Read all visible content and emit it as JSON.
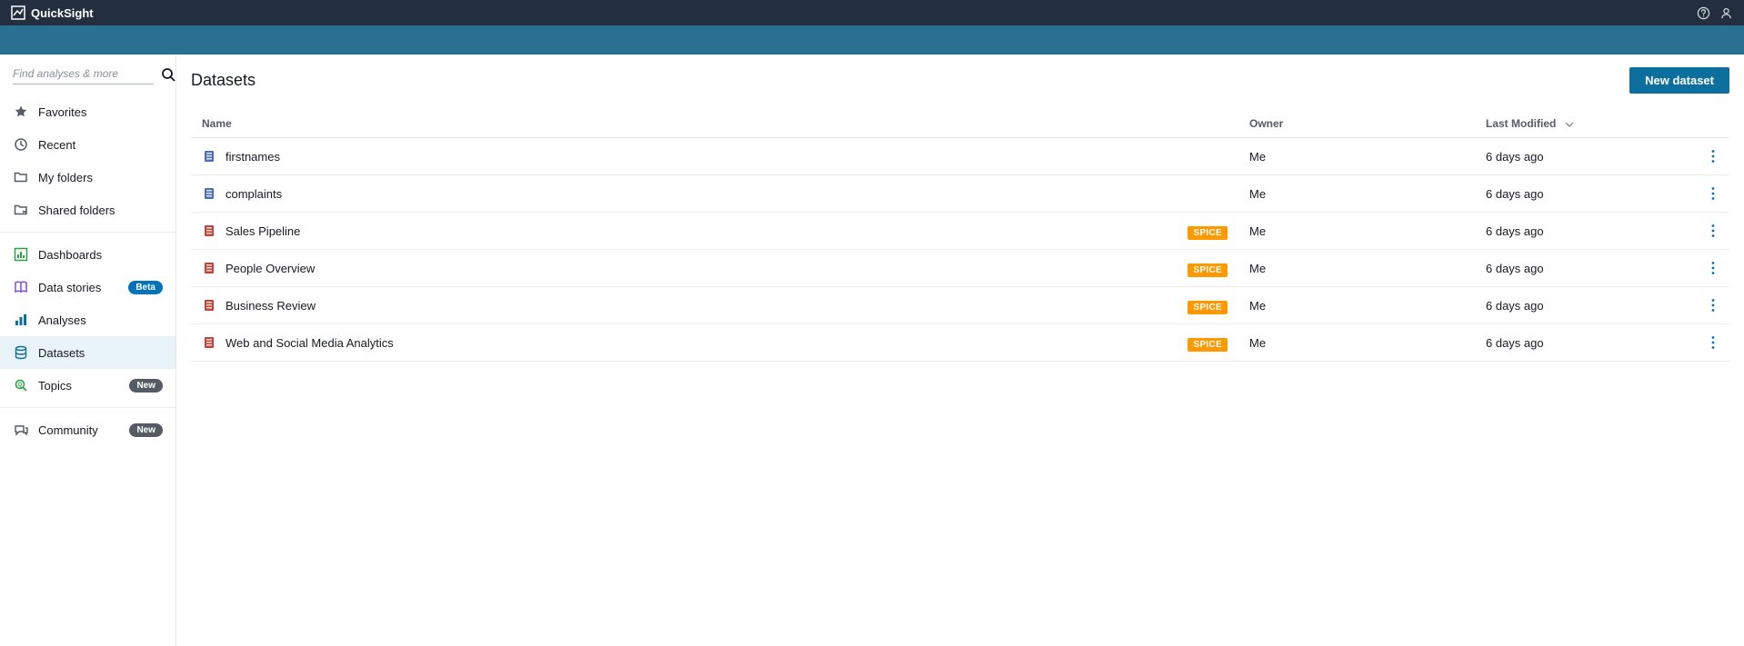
{
  "app_name": "QuickSight",
  "search_placeholder": "Find analyses & more",
  "sidebar": {
    "group1": [
      {
        "id": "favorites",
        "label": "Favorites",
        "icon": "star"
      },
      {
        "id": "recent",
        "label": "Recent",
        "icon": "clock"
      },
      {
        "id": "my-folders",
        "label": "My folders",
        "icon": "folder"
      },
      {
        "id": "shared-folders",
        "label": "Shared folders",
        "icon": "shared-folder"
      }
    ],
    "group2": [
      {
        "id": "dashboards",
        "label": "Dashboards",
        "icon": "dashboard",
        "icon_color": "#2ea043"
      },
      {
        "id": "data-stories",
        "label": "Data stories",
        "icon": "book",
        "icon_color": "#7d4cdb",
        "badge": "Beta",
        "badge_class": "badge-beta"
      },
      {
        "id": "analyses",
        "label": "Analyses",
        "icon": "chart",
        "icon_color": "#0d6f9e"
      },
      {
        "id": "datasets",
        "label": "Datasets",
        "icon": "database",
        "icon_color": "#0d6f9e",
        "active": true
      },
      {
        "id": "topics",
        "label": "Topics",
        "icon": "magnify-q",
        "icon_color": "#2ea043",
        "badge": "New",
        "badge_class": "badge-new"
      }
    ],
    "group3": [
      {
        "id": "community",
        "label": "Community",
        "icon": "community",
        "badge": "New",
        "badge_class": "badge-new"
      }
    ]
  },
  "page": {
    "title": "Datasets",
    "new_button": "New dataset"
  },
  "table": {
    "headers": {
      "name": "Name",
      "owner": "Owner",
      "modified": "Last Modified"
    },
    "rows": [
      {
        "name": "firstnames",
        "owner": "Me",
        "modified": "6 days ago",
        "spice": false,
        "icon_color": "#4a6fb7"
      },
      {
        "name": "complaints",
        "owner": "Me",
        "modified": "6 days ago",
        "spice": false,
        "icon_color": "#4a6fb7"
      },
      {
        "name": "Sales Pipeline",
        "owner": "Me",
        "modified": "6 days ago",
        "spice": true,
        "icon_color": "#c44336"
      },
      {
        "name": "People Overview",
        "owner": "Me",
        "modified": "6 days ago",
        "spice": true,
        "icon_color": "#c44336"
      },
      {
        "name": "Business Review",
        "owner": "Me",
        "modified": "6 days ago",
        "spice": true,
        "icon_color": "#c44336"
      },
      {
        "name": "Web and Social Media Analytics",
        "owner": "Me",
        "modified": "6 days ago",
        "spice": true,
        "icon_color": "#c44336"
      }
    ],
    "spice_label": "SPICE"
  }
}
